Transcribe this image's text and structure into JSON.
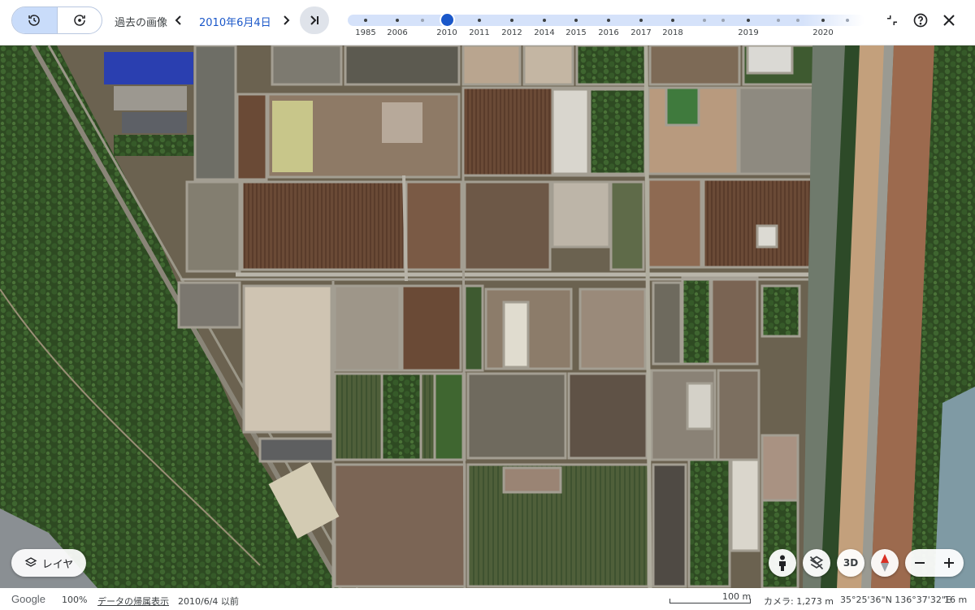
{
  "toolbar": {
    "mode_buttons": [
      {
        "name": "historical-imagery-mode",
        "icon": "history-icon",
        "active": true
      },
      {
        "name": "current-imagery-mode",
        "icon": "refresh-icon",
        "active": false
      }
    ],
    "history_label": "過去の画像",
    "current_date": "2010年6月4日",
    "prev_icon": "chevron-left-icon",
    "next_icon": "chevron-right-icon",
    "latest_icon": "skip-to-latest-icon",
    "collapse_icon": "collapse-icon",
    "help_icon": "help-icon",
    "close_icon": "close-icon"
  },
  "timeline": {
    "years": [
      "1985",
      "2006",
      "2010",
      "2011",
      "2012",
      "2014",
      "2015",
      "2016",
      "2017",
      "2018",
      "2019",
      "2020"
    ],
    "selected_year": "2010",
    "accent_color": "#1a57c9"
  },
  "map": {
    "layers_label": "レイヤ",
    "layers_icon": "layers-icon",
    "controls": [
      "street-view-pegman-icon",
      "reset-tilt-icon",
      "3d-toggle",
      "compass-icon"
    ],
    "three_d_label": "3D",
    "zoom_out_icon": "minus-icon",
    "zoom_in_icon": "plus-icon"
  },
  "status_bar": {
    "logo": "Google",
    "zoom_percent": "100%",
    "attribution_link": "データの帰属表示",
    "imagery_date": "2010/6/4 以前",
    "scale_label": "100 m",
    "camera": "カメラ: 1,273 m",
    "coordinates": "35°25'36\"N 136°37'32\"E",
    "elevation": "16 m"
  }
}
